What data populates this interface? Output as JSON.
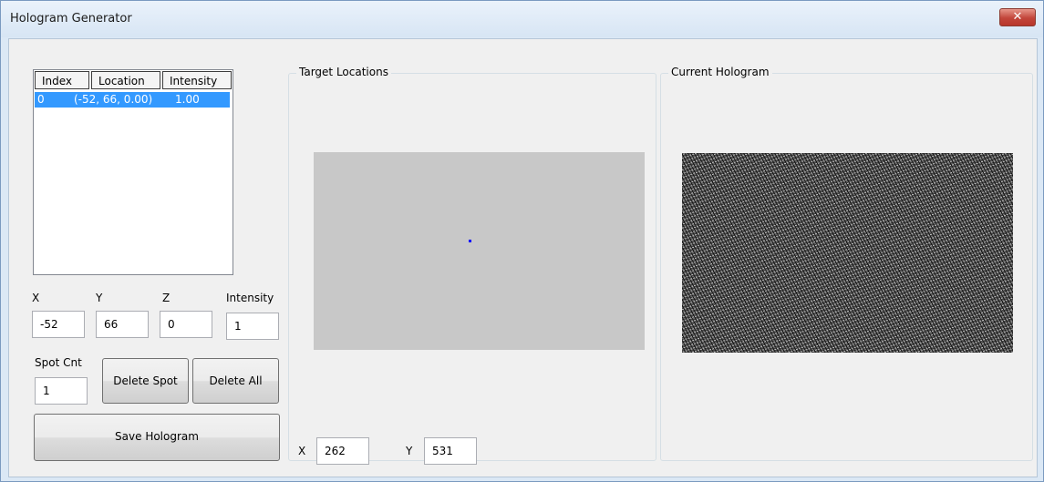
{
  "window": {
    "title": "Hologram Generator",
    "close_glyph": "✕"
  },
  "spot_list": {
    "columns": [
      "Index",
      "Location",
      "Intensity"
    ],
    "rows": [
      {
        "index": "0",
        "location": "(-52, 66, 0.00)",
        "intensity": "1.00"
      }
    ],
    "selection_color": "#3399ff"
  },
  "coords": {
    "x_label": "X",
    "y_label": "Y",
    "z_label": "Z",
    "intensity_label": "Intensity",
    "x_value": "-52",
    "y_value": "66",
    "z_value": "0",
    "intensity_value": "1"
  },
  "spot_count": {
    "label": "Spot Cnt",
    "value": "1"
  },
  "buttons": {
    "delete_spot": "Delete Spot",
    "delete_all": "Delete All",
    "save_hologram": "Save Hologram"
  },
  "target_locations": {
    "title": "Target Locations",
    "x_label": "X",
    "x_value": "262",
    "y_label": "Y",
    "y_value": "531",
    "canvas_color": "#c8c8c8",
    "spot_color": "#0000ff"
  },
  "current_hologram": {
    "title": "Current Hologram"
  }
}
